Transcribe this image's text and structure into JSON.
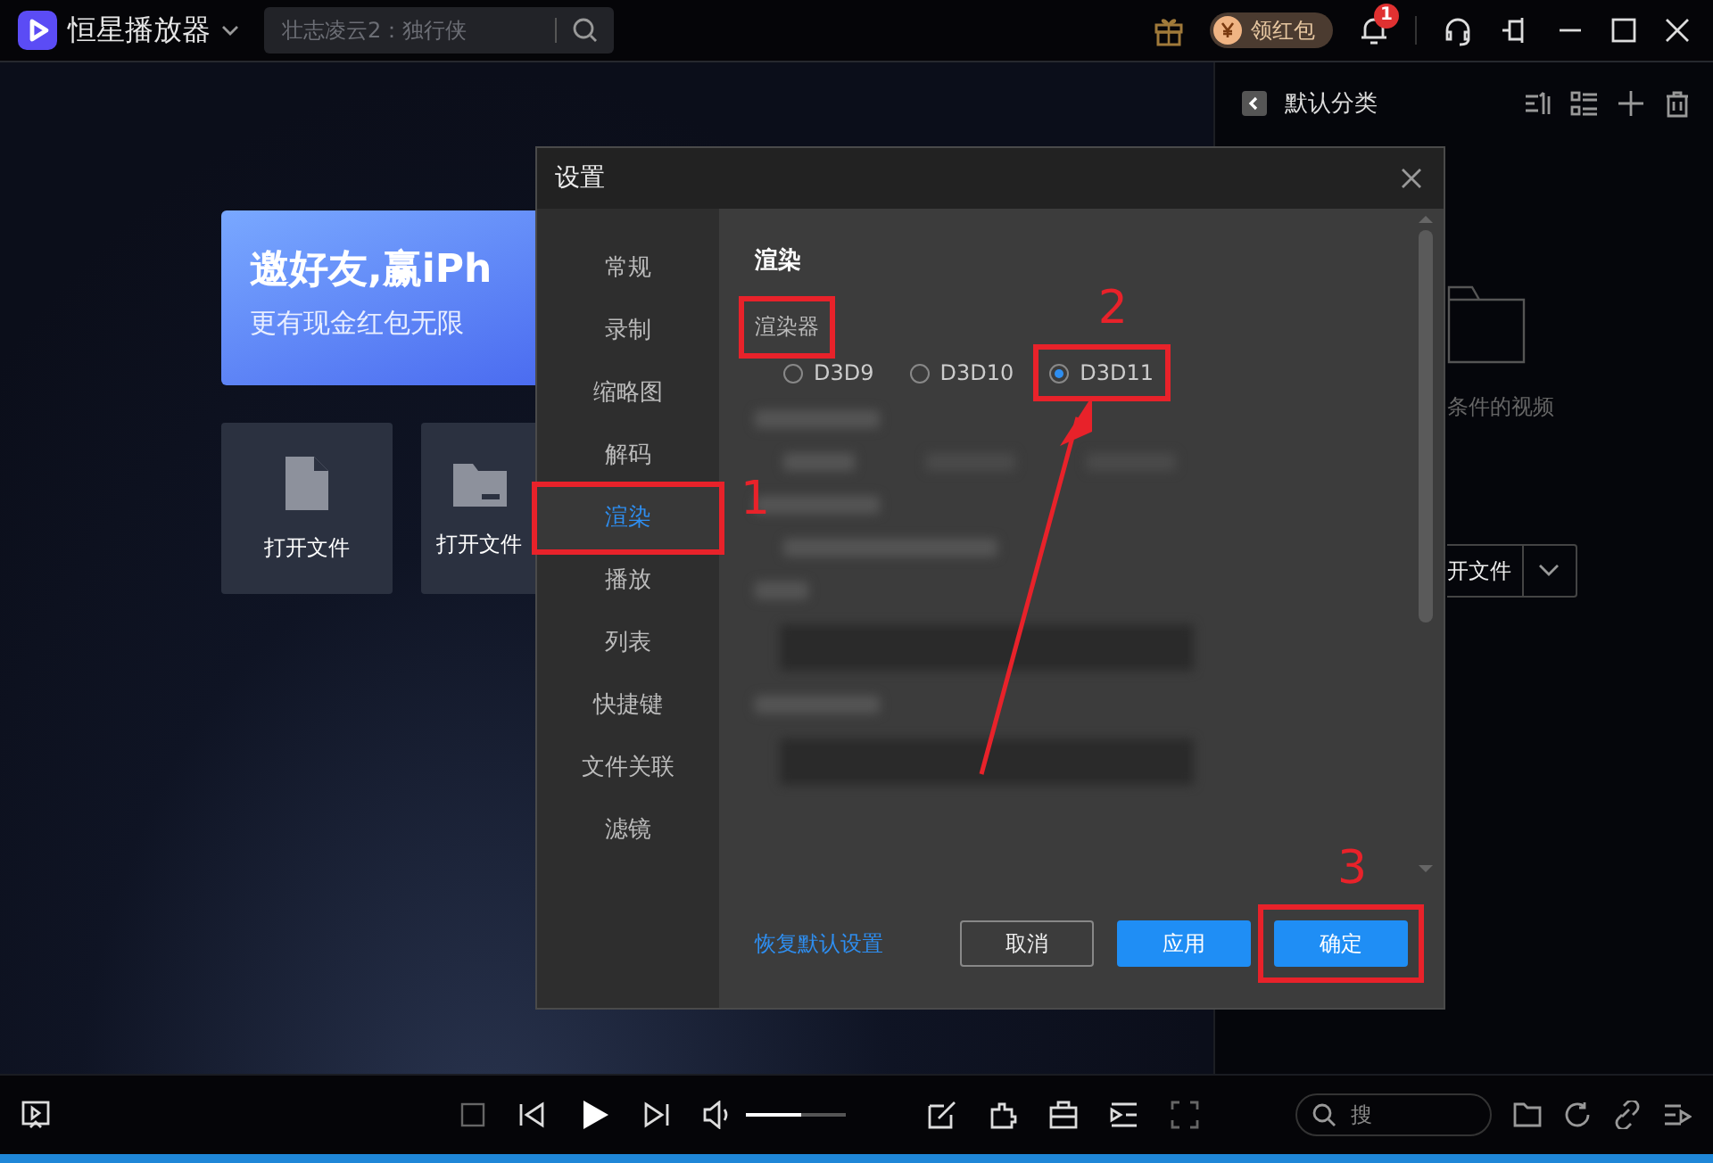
{
  "app": {
    "title": "恒星播放器",
    "search": {
      "placeholder": "壮志凌云2：独行侠"
    },
    "red_packet": "领红包",
    "notification_count": "1"
  },
  "home": {
    "banner": {
      "title": "邀好友,赢iPh",
      "subtitle": "更有现金红包无限"
    },
    "tiles": [
      {
        "label": "打开文件",
        "kind": "file"
      },
      {
        "label": "打开文件",
        "kind": "folder"
      }
    ]
  },
  "playlist": {
    "title": "默认分类",
    "empty_text": "条件的视频",
    "open_button": "开文件"
  },
  "player": {
    "volume": {
      "level": 0.55
    },
    "search": {
      "placeholder": "搜"
    }
  },
  "dialog": {
    "title": "设置",
    "nav": [
      {
        "label": "常规",
        "selected": false
      },
      {
        "label": "录制",
        "selected": false
      },
      {
        "label": "缩略图",
        "selected": false
      },
      {
        "label": "解码",
        "selected": false
      },
      {
        "label": "渲染",
        "selected": true
      },
      {
        "label": "播放",
        "selected": false
      },
      {
        "label": "列表",
        "selected": false
      },
      {
        "label": "快捷键",
        "selected": false
      },
      {
        "label": "文件关联",
        "selected": false
      },
      {
        "label": "滤镜",
        "selected": false
      }
    ],
    "section": "渲染",
    "renderer": {
      "label": "渲染器",
      "options": [
        {
          "label": "D3D9",
          "selected": false
        },
        {
          "label": "D3D10",
          "selected": false
        },
        {
          "label": "D3D11",
          "selected": true
        }
      ]
    },
    "reset_link": "恢复默认设置",
    "buttons": [
      {
        "label": "取消",
        "kind": "secondary"
      },
      {
        "label": "应用",
        "kind": "primary"
      },
      {
        "label": "确定",
        "kind": "primary"
      }
    ]
  },
  "annotations": [
    {
      "label": "1",
      "kind": "nav"
    },
    {
      "label": "2",
      "kind": "option"
    },
    {
      "label": "3",
      "kind": "button"
    }
  ]
}
